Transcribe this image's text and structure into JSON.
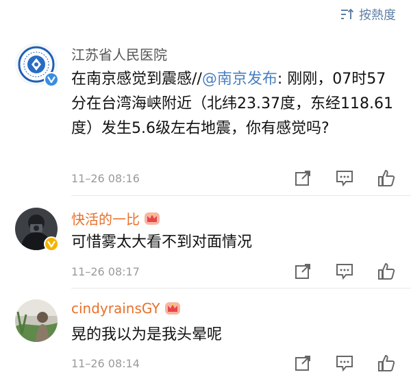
{
  "sort": {
    "label": "按熱度"
  },
  "comments": [
    {
      "username": "江苏省人民医院",
      "text_prefix": "在南京感觉到震感//",
      "mention": "@南京发布",
      "text_rest": ": 刚刚，07时57分在台湾海峡附近（北纬23.37度，东经118.61度）发生5.6级左右地震，你有感觉吗?",
      "time": "11–26 08:16",
      "badge": "blue-v"
    },
    {
      "username": "快活的一比",
      "text": "可惜雾太大看不到对面情况",
      "time": "11–26 08:17",
      "badge": "gold-v",
      "member_crown": true
    },
    {
      "username": "cindyrainsGY",
      "text": "晃的我以为是我头晕呢",
      "time": "11–26 08:14",
      "member_crown": true
    }
  ],
  "colors": {
    "mention": "#4a7fc1",
    "member_name": "#e8702a",
    "official_name": "#555555",
    "timestamp": "#9a9a9a",
    "sort_accent": "#5f7fa6"
  },
  "icons": [
    "sort-icon",
    "repost-icon",
    "comment-icon",
    "like-icon",
    "verified-badge-icon",
    "crown-icon"
  ]
}
